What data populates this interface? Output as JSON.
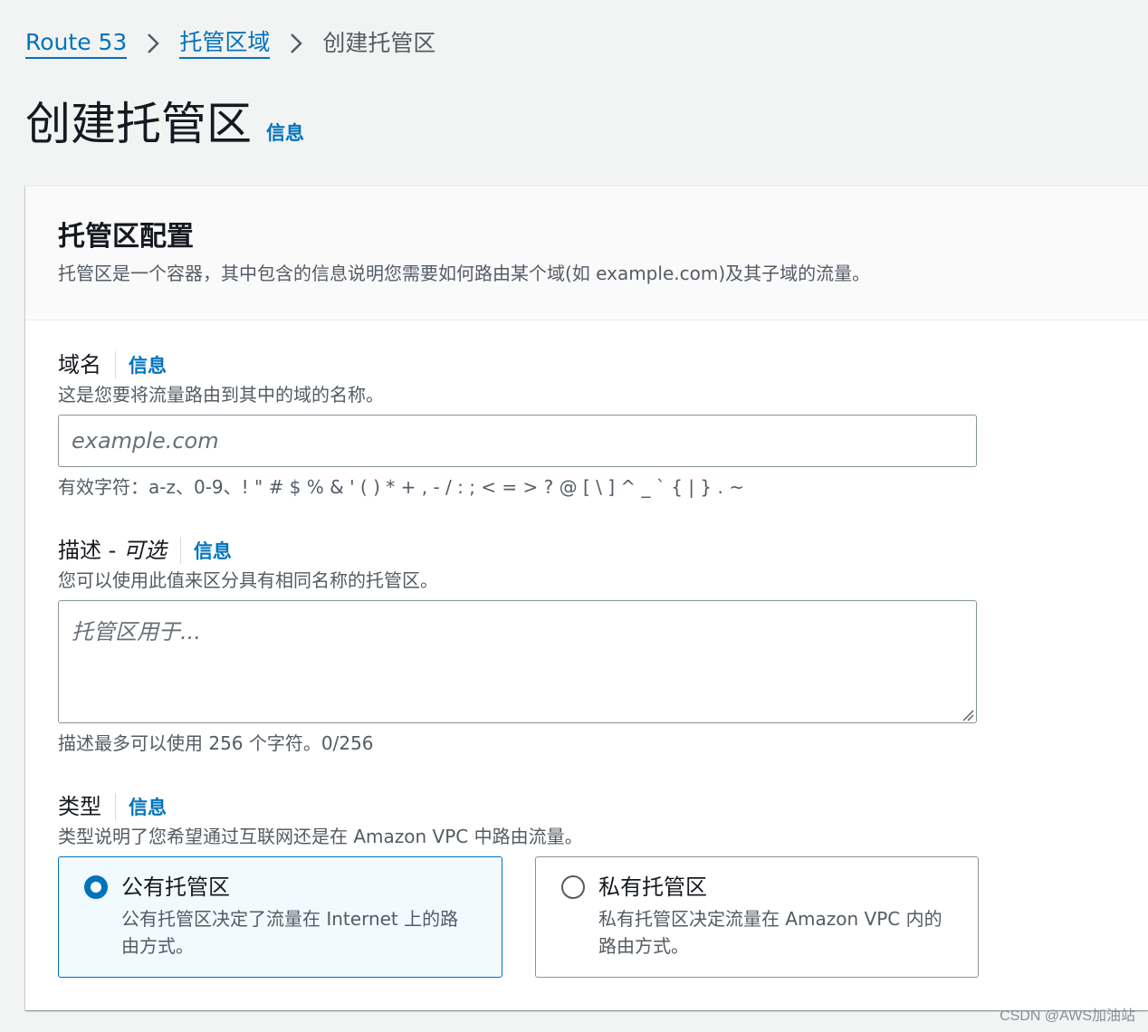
{
  "breadcrumb": {
    "items": [
      "Route 53",
      "托管区域"
    ],
    "current": "创建托管区"
  },
  "page": {
    "title": "创建托管区",
    "info_link": "信息"
  },
  "panel": {
    "title": "托管区配置",
    "description": "托管区是一个容器，其中包含的信息说明您需要如何路由某个域(如 example.com)及其子域的流量。"
  },
  "domain_name": {
    "label": "域名",
    "info_link": "信息",
    "description": "这是您要将流量路由到其中的域的名称。",
    "placeholder": "example.com",
    "value": "",
    "constraint": "有效字符：a-z、0-9、! \" # $ % & ' ( ) * + , - / : ; < = > ? @ [ \\ ] ^ _ ` { | } . ~"
  },
  "description_field": {
    "label": "描述 - ",
    "label_optional": "可选",
    "info_link": "信息",
    "description": "您可以使用此值来区分具有相同名称的托管区。",
    "placeholder": "托管区用于...",
    "value": "",
    "constraint": "描述最多可以使用 256 个字符。0/256"
  },
  "type": {
    "label": "类型",
    "info_link": "信息",
    "description": "类型说明了您希望通过互联网还是在 Amazon VPC 中路由流量。",
    "options": [
      {
        "title": "公有托管区",
        "description": "公有托管区决定了流量在 Internet 上的路由方式。",
        "selected": true
      },
      {
        "title": "私有托管区",
        "description": "私有托管区决定流量在 Amazon VPC 内的路由方式。",
        "selected": false
      }
    ]
  },
  "watermark": "CSDN @AWS加油站",
  "colors": {
    "accent": "#0073bb",
    "page_bg": "#f2f3f3",
    "text_primary": "#16191f",
    "text_secondary": "#545b64",
    "border": "#879596",
    "selected_bg": "#f1faff"
  },
  "icons": {
    "breadcrumb_separator": "chevron-right-icon",
    "radio_selected": "radio-checked-icon",
    "radio_unselected": "radio-unchecked-icon"
  }
}
